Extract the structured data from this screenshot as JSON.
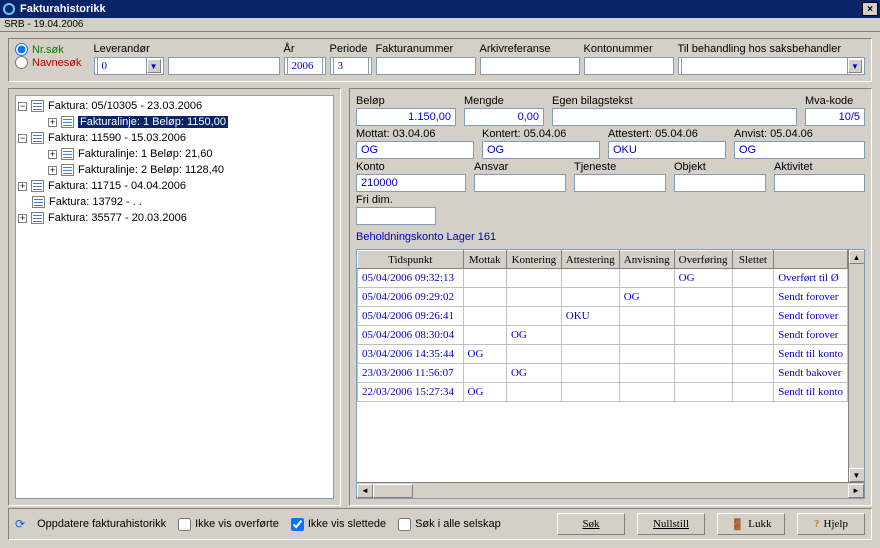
{
  "title": "Fakturahistorikk",
  "subtitle": "SRB - 19.04.2006",
  "filters": {
    "radio_nr": "Nr.søk",
    "radio_name": "Navnesøk",
    "leverandor_label": "Leverandør",
    "leverandor_value": "0",
    "ar_label": "År",
    "ar_value": "2006",
    "periode_label": "Periode",
    "periode_value": "3",
    "fakturanummer_label": "Fakturanummer",
    "arkivreferanse_label": "Arkivreferanse",
    "kontonummer_label": "Kontonummer",
    "behandling_label": "Til behandling hos saksbehandler"
  },
  "tree": {
    "n0": "Faktura: 05/10305 - 23.03.2006",
    "n0_0": "Fakturalinje: 1 Beløp: 1150,00",
    "n1": "Faktura: 11590 - 15.03.2006",
    "n1_0": "Fakturalinje: 1 Beløp: 21,60",
    "n1_1": "Fakturalinje: 2 Beløp: 1128,40",
    "n2": "Faktura: 11715 - 04.04.2006",
    "n3": "Faktura: 13792 -            .  .",
    "n4": "Faktura: 35577 - 20.03.2006"
  },
  "details": {
    "belop_label": "Beløp",
    "belop": "1.150,00",
    "mengde_label": "Mengde",
    "mengde": "0,00",
    "egen_label": "Egen bilagstekst",
    "mva_label": "Mva-kode",
    "mva": "10/5",
    "mottat_label": "Mottat: 03.04.06",
    "mottat": "OG",
    "kontert_label": "Kontert: 05.04.06",
    "kontert": "OG",
    "attestert_label": "Attestert: 05.04.06",
    "attestert": "OKU",
    "anvist_label": "Anvist: 05.04.06",
    "anvist": "OG",
    "konto_label": "Konto",
    "konto": "210000",
    "ansvar_label": "Ansvar",
    "tjeneste_label": "Tjeneste",
    "objekt_label": "Objekt",
    "aktivitet_label": "Aktivitet",
    "fridim_label": "Fri dim.",
    "link": "Beholdningskonto Lager 161"
  },
  "table": {
    "headers": [
      "Tidspunkt",
      "Mottak",
      "Kontering",
      "Attestering",
      "Anvisning",
      "Overføring",
      "Slettet",
      ""
    ],
    "rows": [
      {
        "ts": "05/04/2006 09:32:13",
        "mo": "",
        "ko": "",
        "at": "",
        "an": "",
        "ov": "OG",
        "sl": "",
        "st": "Overført til Ø"
      },
      {
        "ts": "05/04/2006 09:29:02",
        "mo": "",
        "ko": "",
        "at": "",
        "an": "OG",
        "ov": "",
        "sl": "",
        "st": "Sendt forover"
      },
      {
        "ts": "05/04/2006 09:26:41",
        "mo": "",
        "ko": "",
        "at": "OKU",
        "an": "",
        "ov": "",
        "sl": "",
        "st": "Sendt forover"
      },
      {
        "ts": "05/04/2006 08:30:04",
        "mo": "",
        "ko": "OG",
        "at": "",
        "an": "",
        "ov": "",
        "sl": "",
        "st": "Sendt forover"
      },
      {
        "ts": "03/04/2006 14:35:44",
        "mo": "OG",
        "ko": "",
        "at": "",
        "an": "",
        "ov": "",
        "sl": "",
        "st": "Sendt til konto"
      },
      {
        "ts": "23/03/2006 11:56:07",
        "mo": "",
        "ko": "OG",
        "at": "",
        "an": "",
        "ov": "",
        "sl": "",
        "st": "Sendt bakover"
      },
      {
        "ts": "22/03/2006 15:27:34",
        "mo": "OG",
        "ko": "",
        "at": "",
        "an": "",
        "ov": "",
        "sl": "",
        "st": "Sendt til konto"
      }
    ]
  },
  "bottom": {
    "refresh": "Oppdatere fakturahistorikk",
    "chk1": "Ikke vis overførte",
    "chk2": "Ikke vis slettede",
    "chk3": "Søk i alle selskap",
    "sok": "Søk",
    "nullstill": "Nullstill",
    "lukk": "Lukk",
    "hjelp": "Hjelp"
  }
}
